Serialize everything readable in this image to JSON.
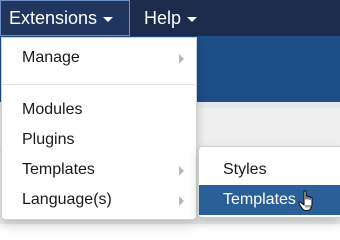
{
  "navbar": {
    "items": [
      {
        "label": "Extensions"
      },
      {
        "label": "Help"
      }
    ]
  },
  "dropdown": {
    "items": [
      {
        "label": "Manage",
        "has_submenu": true
      },
      {
        "label": "Modules",
        "has_submenu": false
      },
      {
        "label": "Plugins",
        "has_submenu": false
      },
      {
        "label": "Templates",
        "has_submenu": true
      },
      {
        "label": "Language(s)",
        "has_submenu": true
      }
    ]
  },
  "submenu": {
    "items": [
      {
        "label": "Styles",
        "active": false
      },
      {
        "label": "Templates",
        "active": true
      }
    ]
  },
  "colors": {
    "navbar_bg": "#1b2b4c",
    "page_band": "#1e4e86",
    "active_item_bg": "#2b5f97"
  },
  "cursor": {
    "icon": "hand-pointer-icon"
  }
}
